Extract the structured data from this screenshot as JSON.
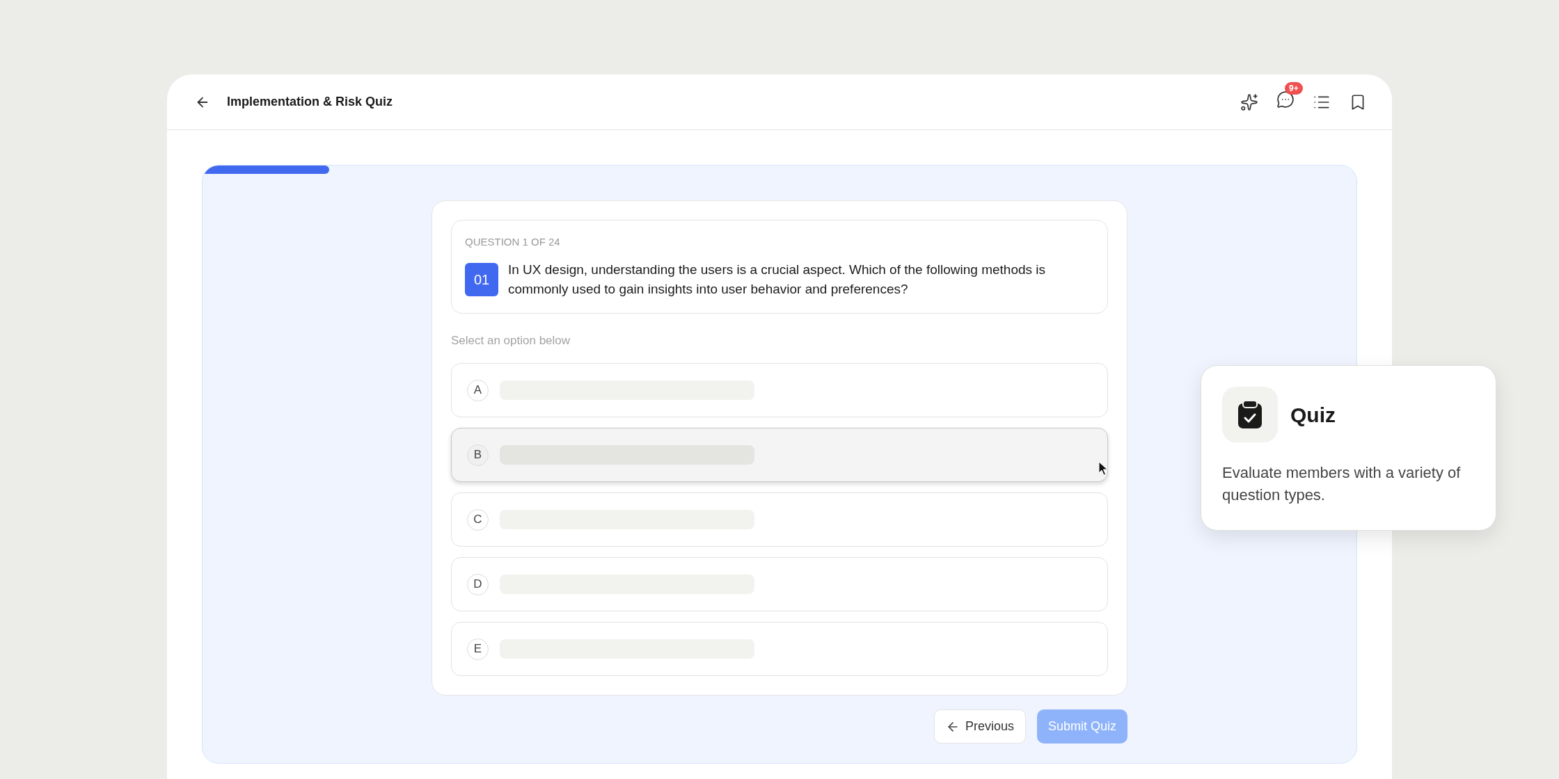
{
  "header": {
    "title": "Implementation & Risk Quiz",
    "notification_badge": "9+"
  },
  "progress": {
    "level": 0.11
  },
  "question": {
    "counter": "QUESTION 1 OF 24",
    "number": "01",
    "text": "In UX design, understanding the users is a crucial aspect. Which of the following methods is commonly used to gain insights into user behavior and preferences?"
  },
  "instruction": "Select an option below",
  "options": [
    {
      "letter": "A",
      "selected": false
    },
    {
      "letter": "B",
      "selected": true
    },
    {
      "letter": "C",
      "selected": false
    },
    {
      "letter": "D",
      "selected": false
    },
    {
      "letter": "E",
      "selected": false
    }
  ],
  "buttons": {
    "previous": "Previous",
    "submit": {
      "label": "Submit Quiz",
      "disabled": true
    }
  },
  "popover": {
    "title": "Quiz",
    "description": "Evaluate members with a variety of question types."
  }
}
